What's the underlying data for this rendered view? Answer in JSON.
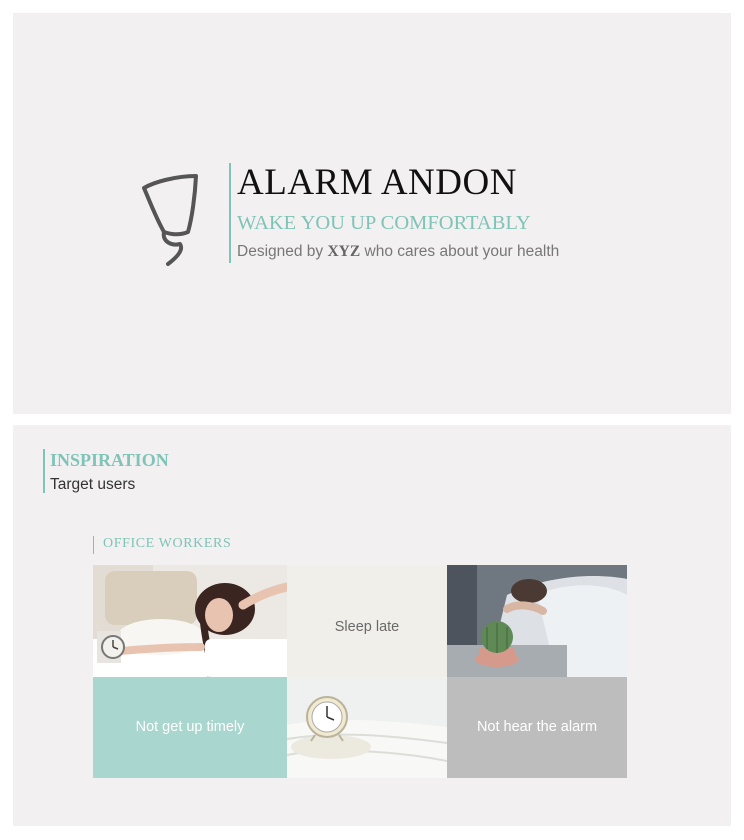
{
  "hero": {
    "logo_icon": "alarm-andon-logo-icon",
    "title": "ALARM ANDON",
    "tagline": "WAKE YOU UP COMFORTABLY",
    "byline_prefix": "Designed by ",
    "byline_author": "XYZ",
    "byline_suffix": " who cares about your health"
  },
  "inspiration": {
    "title": "INSPIRATION",
    "subtitle": "Target users",
    "group_title": "OFFICE WORKERS",
    "tiles": [
      {
        "kind": "photo",
        "subject": "woman-stretching-alarm-clock-photo"
      },
      {
        "kind": "text",
        "label": "Sleep late"
      },
      {
        "kind": "photo",
        "subject": "hand-on-cactus-bedside-photo"
      },
      {
        "kind": "text",
        "label": "Not get up timely"
      },
      {
        "kind": "photo",
        "subject": "alarm-clock-on-towels-photo"
      },
      {
        "kind": "text",
        "label": "Not hear the alarm"
      }
    ]
  },
  "colors": {
    "accent": "#7fc4b7",
    "panel_bg": "#f2f0f1",
    "tile_teal": "#a9d6ce",
    "tile_gray": "#bdbdbd",
    "tile_cream": "#f0efea"
  }
}
